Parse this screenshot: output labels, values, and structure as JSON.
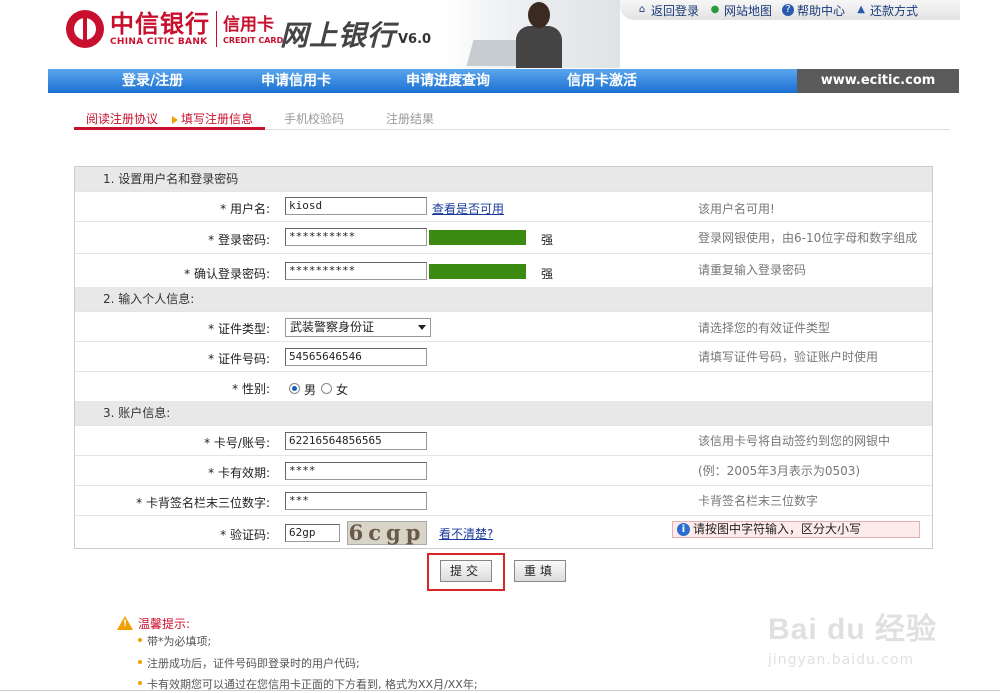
{
  "header": {
    "logo_cn": "中信银行",
    "logo_en": "CHINA CITIC BANK",
    "card_cn": "信用卡",
    "card_en": "CREDIT CARD",
    "netbank": "网上银行",
    "version": "V6.0",
    "top_links": [
      {
        "label": "返回登录",
        "icon": "home-icon"
      },
      {
        "label": "网站地图",
        "icon": "sitemap-icon"
      },
      {
        "label": "帮助中心",
        "icon": "help-icon"
      },
      {
        "label": "还款方式",
        "icon": "repay-icon"
      }
    ]
  },
  "nav": {
    "items": [
      "登录/注册",
      "申请信用卡",
      "申请进度查询",
      "信用卡激活"
    ],
    "url": "www.ecitic.com"
  },
  "steps": {
    "items": [
      "阅读注册协议",
      "填写注册信息",
      "手机校验码",
      "注册结果"
    ],
    "active_index": 1
  },
  "form": {
    "section1": "1. 设置用户名和登录密码",
    "section2": "2. 输入个人信息:",
    "section3": "3. 账户信息:",
    "username": {
      "label": "* 用户名:",
      "value": "kiosd",
      "link": "查看是否可用",
      "hint": "该用户名可用!"
    },
    "password": {
      "label": "* 登录密码:",
      "value": "**********",
      "strength": "强",
      "hint": "登录网银使用，由6-10位字母和数字组成"
    },
    "confirm_password": {
      "label": "* 确认登录密码:",
      "value": "**********",
      "strength": "强",
      "hint": "请重复输入登录密码"
    },
    "id_type": {
      "label": "* 证件类型:",
      "value": "武装警察身份证",
      "hint": "请选择您的有效证件类型"
    },
    "id_number": {
      "label": "* 证件号码:",
      "value": "54565646546",
      "hint": "请填写证件号码，验证账户时使用"
    },
    "gender": {
      "label": "* 性别:",
      "options": [
        "男",
        "女"
      ],
      "selected": "男"
    },
    "card_number": {
      "label": "* 卡号/账号:",
      "value": "62216564856565",
      "hint": "该信用卡号将自动签约到您的网银中"
    },
    "expiry": {
      "label": "* 卡有效期:",
      "value": "****",
      "hint": "(例：2005年3月表示为0503)"
    },
    "cvv": {
      "label": "* 卡背签名栏末三位数字:",
      "value": "***",
      "hint": "卡背签名栏末三位数字"
    },
    "captcha": {
      "label": "* 验证码:",
      "value": "62gp",
      "image_text": "6cgp",
      "link": "看不清楚?",
      "tip": "请按图中字符输入，区分大小写"
    }
  },
  "buttons": {
    "submit": "提交",
    "reset": "重填"
  },
  "tips": {
    "title": "温馨提示:",
    "items": [
      "带*为必填项;",
      "注册成功后，证件号码即登录时的用户代码;",
      "卡有效期您可以通过在您信用卡正面的下方看到, 格式为XX月/XX年;"
    ]
  },
  "watermark": {
    "main": "Bai du 经验",
    "sub": "jingyan.baidu.com"
  }
}
